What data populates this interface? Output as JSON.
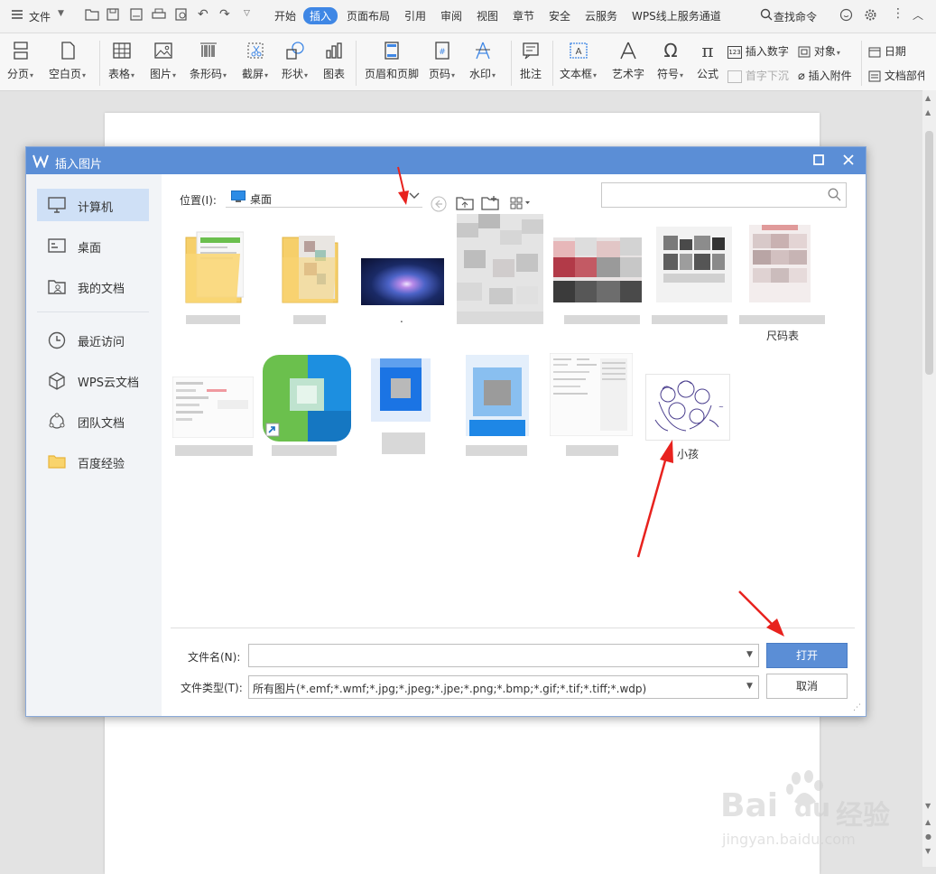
{
  "menubar": {
    "file": "文件",
    "tabs": [
      "开始",
      "插入",
      "页面布局",
      "引用",
      "审阅",
      "视图",
      "章节",
      "安全",
      "云服务",
      "WPS线上服务通道"
    ],
    "active_tab": "插入",
    "search": "查找命令",
    "accent": "#3f87e5"
  },
  "ribbon": {
    "page_break": "分页",
    "blank_page": "空白页",
    "table": "表格",
    "picture": "图片",
    "barcode": "条形码",
    "screenshot": "截屏",
    "shape": "形状",
    "chart": "图表",
    "header_footer": "页眉和页脚",
    "page_number": "页码",
    "watermark": "水印",
    "comment": "批注",
    "textbox": "文本框",
    "wordart": "艺术字",
    "symbol": "符号",
    "formula": "公式",
    "insert_number": "插入数字",
    "drop_cap": "首字下沉",
    "object": "对象",
    "attachment": "插入附件",
    "date": "日期",
    "doc_part": "文档部件"
  },
  "dialog": {
    "title": "插入图片",
    "title_color": "#5b8ed6",
    "sidebar": [
      {
        "label": "计算机",
        "icon": "monitor-icon"
      },
      {
        "label": "桌面",
        "icon": "desktop-icon"
      },
      {
        "label": "我的文档",
        "icon": "my-documents-icon"
      },
      {
        "label": "最近访问",
        "icon": "clock-icon"
      },
      {
        "label": "WPS云文档",
        "icon": "cube-icon"
      },
      {
        "label": "团队文档",
        "icon": "team-icon"
      },
      {
        "label": "百度经验",
        "icon": "folder-icon"
      }
    ],
    "location_label": "位置(I):",
    "location_value": "桌面",
    "files_row1": [
      {
        "label": "",
        "kind": "folder"
      },
      {
        "label": "",
        "kind": "folder"
      },
      {
        "label": ".",
        "kind": "image-galaxy"
      },
      {
        "label": "",
        "kind": "image-blurred"
      },
      {
        "label": "",
        "kind": "image-blurred"
      },
      {
        "label": "",
        "kind": "image-blurred"
      },
      {
        "label": "尺码表",
        "kind": "image-blurred"
      }
    ],
    "files_row2": [
      {
        "label": "",
        "kind": "doc"
      },
      {
        "label": "",
        "kind": "shortcut"
      },
      {
        "label": "",
        "kind": "app"
      },
      {
        "label": "",
        "kind": "app"
      },
      {
        "label": "",
        "kind": "doc"
      },
      {
        "label": "小孩",
        "kind": "image-sketch"
      }
    ],
    "filename_label": "文件名(N):",
    "filename_value": "",
    "filetype_label": "文件类型(T):",
    "filetype_value": "所有图片(*.emf;*.wmf;*.jpg;*.jpeg;*.jpe;*.png;*.bmp;*.gif;*.tif;*.tiff;*.wdp)",
    "open_button": "打开",
    "cancel_button": "取消",
    "open_color": "#5b8ed6"
  },
  "watermark": {
    "brand": "Bai",
    "brand2": "du",
    "site_cn": "经验",
    "url": "jingyan.baidu.com"
  }
}
